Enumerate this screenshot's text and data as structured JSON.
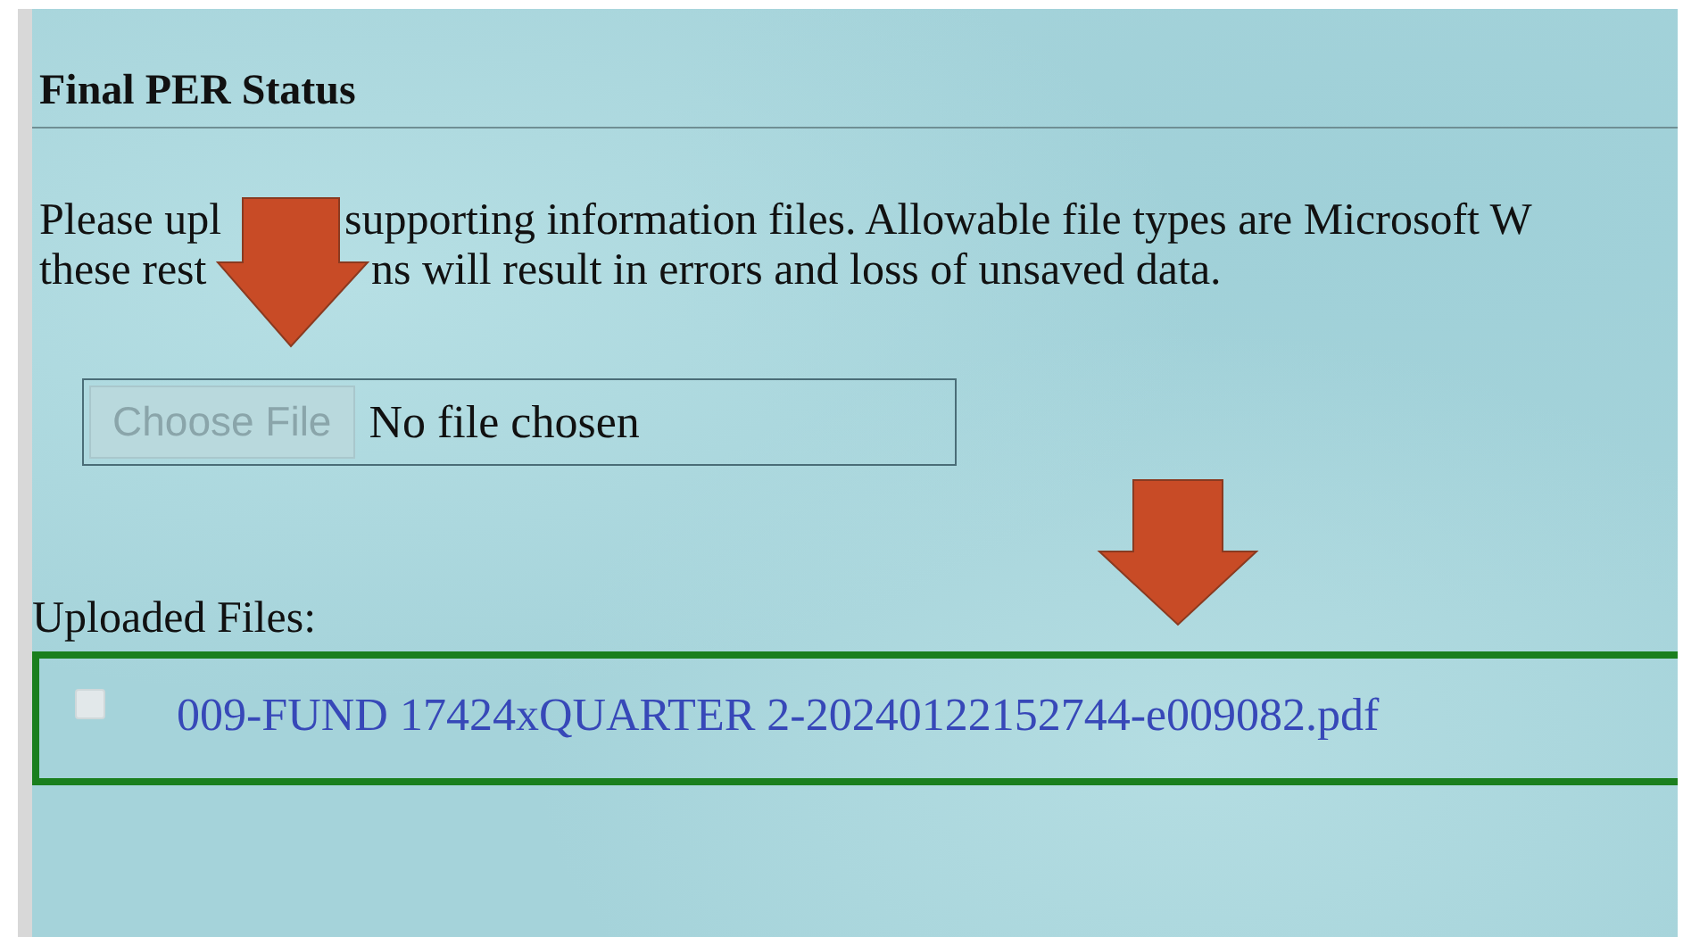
{
  "section": {
    "title": "Final PER Status"
  },
  "instructions": {
    "lines": [
      {
        "before": "Please upl",
        "after": "supporting information files. Allowable file types are Microsoft W"
      },
      {
        "before": "these rest",
        "after": "ns will result in errors and loss of unsaved data."
      }
    ]
  },
  "file_input": {
    "button": "Choose File",
    "disabled": true,
    "status": "No file chosen"
  },
  "uploaded": {
    "label": "Uploaded Files:",
    "files": [
      {
        "name": "009-FUND 17424xQUARTER 2-20240122152744-e009082.pdf",
        "checked": false
      }
    ]
  }
}
